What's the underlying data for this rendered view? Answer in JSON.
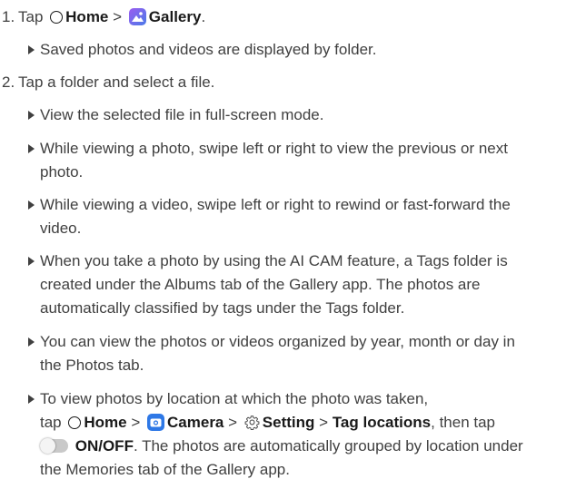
{
  "steps": [
    {
      "number": "1.",
      "tap": "Tap",
      "home": "Home",
      "sep": ">",
      "gallery": "Gallery",
      "end": "."
    },
    {
      "number": "2.",
      "text": "Tap a folder and select a file."
    }
  ],
  "bullets": {
    "b0": [
      "Saved photos and videos are displayed by folder."
    ],
    "b1": [
      "View the selected file in full-screen mode."
    ],
    "b2": [
      "While viewing a photo, swipe left or right to view the previous or next",
      "photo."
    ],
    "b3": [
      "While viewing a video, swipe left or right to rewind or fast-forward the",
      "video."
    ],
    "b4": [
      "When you take a photo by using the AI CAM feature, a Tags folder is",
      "created under the Albums tab of the Gallery app. The photos are",
      "automatically classified by tags under the Tags folder."
    ],
    "b5": [
      "You can view the photos or videos organized by year, month or day in",
      "the Photos tab."
    ],
    "b6": {
      "line1": "To view photos by location at which the photo was taken,",
      "tap": "tap",
      "home": "Home",
      "sep": ">",
      "camera": "Camera",
      "setting": "Setting",
      "tag_locations": "Tag locations",
      "then_tap": ", then tap",
      "onoff": "ON/OFF",
      "after_onoff": ". The photos are automatically grouped by location under",
      "line4": "the Memories tab of the Gallery app."
    }
  },
  "icons": {
    "home": "home-circle-icon",
    "gallery": "gallery-app-icon",
    "camera": "camera-app-icon",
    "setting": "gear-icon",
    "toggle": "toggle-switch-icon"
  },
  "colors": {
    "text": "#404040",
    "ui_text": "#1a1a1a",
    "gallery_icon": "#7a6ff0",
    "camera_icon": "#2e78e6"
  }
}
